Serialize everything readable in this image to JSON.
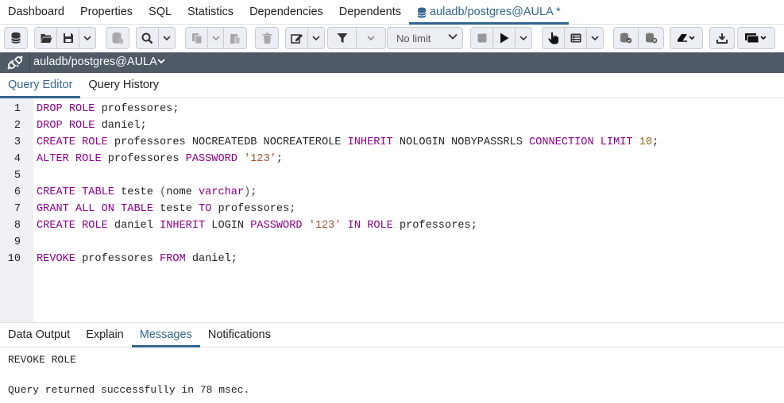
{
  "top_tabs": [
    {
      "label": "Dashboard"
    },
    {
      "label": "Properties"
    },
    {
      "label": "SQL"
    },
    {
      "label": "Statistics"
    },
    {
      "label": "Dependencies"
    },
    {
      "label": "Dependents"
    },
    {
      "label": "auladb/postgres@AULA *",
      "icon": "database-icon",
      "active": true
    }
  ],
  "toolbar": {
    "limit_select": "No limit"
  },
  "connection": {
    "label": "auladb/postgres@AULA",
    "icon": "disconnect-plug-icon"
  },
  "editor_tabs": [
    {
      "label": "Query Editor",
      "active": true
    },
    {
      "label": "Query History"
    }
  ],
  "editor": {
    "lines": [
      {
        "n": "1",
        "tokens": [
          [
            "kw",
            "DROP"
          ],
          [
            "t",
            " "
          ],
          [
            "kw",
            "ROLE"
          ],
          [
            "t",
            " professores;"
          ]
        ]
      },
      {
        "n": "2",
        "tokens": [
          [
            "kw",
            "DROP"
          ],
          [
            "t",
            " "
          ],
          [
            "kw",
            "ROLE"
          ],
          [
            "t",
            " daniel;"
          ]
        ]
      },
      {
        "n": "3",
        "tokens": [
          [
            "kw",
            "CREATE"
          ],
          [
            "t",
            " "
          ],
          [
            "kw",
            "ROLE"
          ],
          [
            "t",
            " professores NOCREATEDB NOCREATEROLE "
          ],
          [
            "kw",
            "INHERIT"
          ],
          [
            "t",
            " NOLOGIN NOBYPASSRLS "
          ],
          [
            "kw",
            "CONNECTION LIMIT"
          ],
          [
            "t",
            " "
          ],
          [
            "num",
            "10"
          ],
          [
            "t",
            ";"
          ]
        ]
      },
      {
        "n": "4",
        "tokens": [
          [
            "kw",
            "ALTER"
          ],
          [
            "t",
            " "
          ],
          [
            "kw",
            "ROLE"
          ],
          [
            "t",
            " professores "
          ],
          [
            "kw",
            "PASSWORD"
          ],
          [
            "t",
            " "
          ],
          [
            "str",
            "'123'"
          ],
          [
            "t",
            ";"
          ]
        ]
      },
      {
        "n": "5",
        "tokens": []
      },
      {
        "n": "6",
        "tokens": [
          [
            "kw",
            "CREATE"
          ],
          [
            "t",
            " "
          ],
          [
            "kw",
            "TABLE"
          ],
          [
            "t",
            " teste "
          ],
          [
            "op",
            "("
          ],
          [
            "t",
            "nome "
          ],
          [
            "fn",
            "varchar"
          ],
          [
            "op",
            ")"
          ],
          [
            "t",
            ";"
          ]
        ]
      },
      {
        "n": "7",
        "tokens": [
          [
            "kw",
            "GRANT"
          ],
          [
            "t",
            " "
          ],
          [
            "kw",
            "ALL"
          ],
          [
            "t",
            " "
          ],
          [
            "kw",
            "ON"
          ],
          [
            "t",
            " "
          ],
          [
            "kw",
            "TABLE"
          ],
          [
            "t",
            " teste "
          ],
          [
            "kw",
            "TO"
          ],
          [
            "t",
            " professores;"
          ]
        ]
      },
      {
        "n": "8",
        "tokens": [
          [
            "kw",
            "CREATE"
          ],
          [
            "t",
            " "
          ],
          [
            "kw",
            "ROLE"
          ],
          [
            "t",
            " daniel "
          ],
          [
            "kw",
            "INHERIT"
          ],
          [
            "t",
            " LOGIN "
          ],
          [
            "kw",
            "PASSWORD"
          ],
          [
            "t",
            " "
          ],
          [
            "str",
            "'123'"
          ],
          [
            "t",
            " "
          ],
          [
            "kw",
            "IN"
          ],
          [
            "t",
            " "
          ],
          [
            "kw",
            "ROLE"
          ],
          [
            "t",
            " professores;"
          ]
        ]
      },
      {
        "n": "9",
        "tokens": []
      },
      {
        "n": "10",
        "tokens": [
          [
            "kw",
            "REVOKE"
          ],
          [
            "t",
            " professores "
          ],
          [
            "kw",
            "FROM"
          ],
          [
            "t",
            " daniel;"
          ]
        ]
      }
    ]
  },
  "result_tabs": [
    {
      "label": "Data Output"
    },
    {
      "label": "Explain"
    },
    {
      "label": "Messages",
      "active": true
    },
    {
      "label": "Notifications"
    }
  ],
  "messages": {
    "command": "REVOKE ROLE",
    "result": "Query returned successfully in 78 msec."
  },
  "colors": {
    "accent": "#326690",
    "keyword": "#8b008b",
    "string": "#a0522d",
    "number": "#8b6914",
    "connection_bar": "#4f5a66"
  }
}
